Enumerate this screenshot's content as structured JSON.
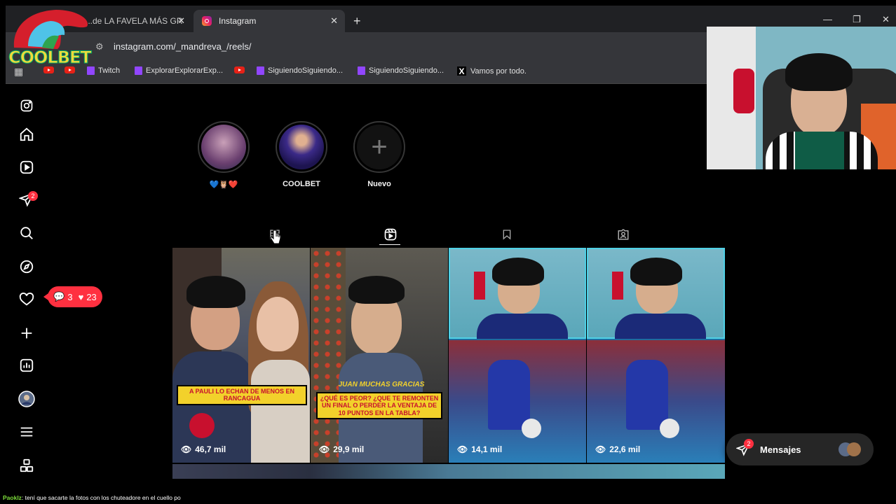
{
  "browser": {
    "tabs": [
      {
        "title": "...de LA FAVELA MÁS GR"
      },
      {
        "title": "Instagram"
      }
    ],
    "url": "instagram.com/_mandreva_/reels/",
    "bookmarks": [
      {
        "label": "Twitch",
        "icon": "twitch-icon"
      },
      {
        "label": "ExplorarExplorarExp...",
        "icon": "twitch-icon"
      },
      {
        "label": "SiguiendoSiguiendo...",
        "icon": "twitch-icon"
      },
      {
        "label": "SiguiendoSiguiendo...",
        "icon": "twitch-icon"
      },
      {
        "label": "Vamos por todo.",
        "icon": "x-icon"
      }
    ]
  },
  "overlay": {
    "brand": "COOLBET",
    "notifications": {
      "comments": "3",
      "likes": "23"
    },
    "chat_user": "Paoklz",
    "chat_message": ": tení que sacarte la fotos con los chuteadore en el cuello po"
  },
  "instagram": {
    "nav_badge": "2",
    "highlights": [
      {
        "label": "💙🦉❤️"
      },
      {
        "label": "COOLBET"
      },
      {
        "label": "Nuevo"
      }
    ],
    "reels": [
      {
        "views": "46,7 mil",
        "caption": "A PAULI LO ECHAN DE MENOS EN RANCAGUA"
      },
      {
        "views": "29,9 mil",
        "caption_name": "JUAN MUCHAS GRACIAS",
        "caption": "¿QUÉ ES PEOR? ¿QUE TE REMONTEN UN FINAL O PERDER LA VENTAJA DE 10 PUNTOS EN LA TABLA?"
      },
      {
        "views": "14,1 mil"
      },
      {
        "views": "22,6 mil"
      }
    ],
    "messages": {
      "label": "Mensajes",
      "badge": "2"
    }
  },
  "colors": {
    "accent_red": "#ff3040",
    "caption_yellow": "#f2d12b",
    "reel_bg_blue": "#2b6cb0"
  }
}
